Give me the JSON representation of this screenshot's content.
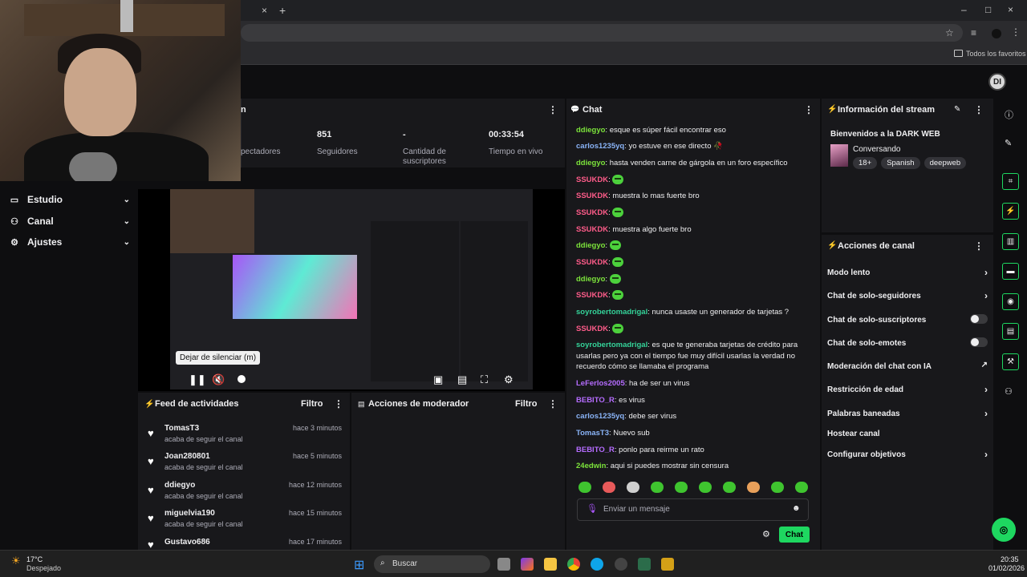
{
  "browser": {
    "new_tab": "+",
    "close_tab": "×",
    "bookmarks_label": "Todos los favoritos",
    "window_controls": [
      "–",
      "□",
      "×"
    ]
  },
  "app": {
    "user_initials": "DI"
  },
  "stats": {
    "title": "n",
    "items": [
      {
        "value": "",
        "label": "pectadores"
      },
      {
        "value": "851",
        "label": "Seguidores"
      },
      {
        "value": "-",
        "label": "Cantidad de suscriptores"
      },
      {
        "value": "00:33:54",
        "label": "Tiempo en vivo"
      }
    ]
  },
  "nav": {
    "items": [
      {
        "label": "Estudio",
        "icon": "monitor-icon"
      },
      {
        "label": "Canal",
        "icon": "users-icon"
      },
      {
        "label": "Ajustes",
        "icon": "gear-icon"
      }
    ]
  },
  "player": {
    "tooltip": "Dejar de silenciar (m)"
  },
  "feed": {
    "title": "Feed de actividades",
    "filter": "Filtro",
    "rows": [
      {
        "name": "TomasT3",
        "action": "acaba de seguir el canal",
        "time": "hace 3 minutos"
      },
      {
        "name": "Joan280801",
        "action": "acaba de seguir el canal",
        "time": "hace 5 minutos"
      },
      {
        "name": "ddiegyo",
        "action": "acaba de seguir el canal",
        "time": "hace 12 minutos"
      },
      {
        "name": "miguelvia190",
        "action": "acaba de seguir el canal",
        "time": "hace 15 minutos"
      },
      {
        "name": "Gustavo686",
        "action": "",
        "time": "hace 17 minutos"
      }
    ]
  },
  "mod": {
    "title": "Acciones de moderador",
    "filter": "Filtro"
  },
  "chat": {
    "title": "Chat",
    "messages": [
      {
        "user": "ddiegyo",
        "color": "#7ce33b",
        "text": "esque es súper fácil encontrar eso",
        "emote": false
      },
      {
        "user": "carlos1235yq",
        "color": "#8ab4f8",
        "text": "yo estuve en ese directo 🥀",
        "emote": false
      },
      {
        "user": "ddiegyo",
        "color": "#7ce33b",
        "text": "hasta venden carne de gárgola en un foro específico",
        "emote": false
      },
      {
        "user": "SSUKDK",
        "color": "#ff5c8a",
        "text": "",
        "emote": true
      },
      {
        "user": "SSUKDK",
        "color": "#ff5c8a",
        "text": "muestra lo mas fuerte bro",
        "emote": false
      },
      {
        "user": "SSUKDK",
        "color": "#ff5c8a",
        "text": "",
        "emote": true
      },
      {
        "user": "SSUKDK",
        "color": "#ff5c8a",
        "text": "muestra algo fuerte bro",
        "emote": false
      },
      {
        "user": "ddiegyo",
        "color": "#7ce33b",
        "text": "",
        "emote": true
      },
      {
        "user": "SSUKDK",
        "color": "#ff5c8a",
        "text": "",
        "emote": true
      },
      {
        "user": "ddiegyo",
        "color": "#7ce33b",
        "text": "",
        "emote": true
      },
      {
        "user": "SSUKDK",
        "color": "#ff5c8a",
        "text": "",
        "emote": true
      },
      {
        "user": "soyrobertomadrigal",
        "color": "#34d399",
        "text": "nunca usaste un generador de tarjetas ?",
        "emote": false
      },
      {
        "user": "SSUKDK",
        "color": "#ff5c8a",
        "text": "",
        "emote": true
      },
      {
        "user": "soyrobertomadrigal",
        "color": "#34d399",
        "text": "es que te generaba tarjetas de crédito para usarlas pero ya con el tiempo fue muy difícil usarlas la verdad no recuerdo cómo se llamaba el programa",
        "emote": false
      },
      {
        "user": "LeFerlos2005",
        "color": "#b56cff",
        "text": "ha de ser un virus",
        "emote": false
      },
      {
        "user": "BEBITO_R",
        "color": "#b56cff",
        "text": "es virus",
        "emote": false
      },
      {
        "user": "carlos1235yq",
        "color": "#8ab4f8",
        "text": "debe ser virus",
        "emote": false
      },
      {
        "user": "TomasT3",
        "color": "#8ab4f8",
        "text": "Nuevo sub",
        "emote": false
      },
      {
        "user": "BEBITO_R",
        "color": "#b56cff",
        "text": "ponlo para reirme un rato",
        "emote": false
      },
      {
        "user": "24edwin",
        "color": "#7ce33b",
        "text": "aqui si puedes mostrar sin censura",
        "emote": false
      }
    ],
    "placeholder": "Enviar un mensaje",
    "send": "Chat"
  },
  "info": {
    "title": "Información del stream",
    "stream_title": "Bienvenidos a la DARK WEB",
    "category": "Conversando",
    "tags": [
      "18+",
      "Spanish",
      "deepweb"
    ]
  },
  "actions": {
    "title": "Acciones de canal",
    "items": [
      {
        "label": "Modo lento",
        "kind": "chevron"
      },
      {
        "label": "Chat de solo-seguidores",
        "kind": "chevron"
      },
      {
        "label": "Chat de solo-suscriptores",
        "kind": "toggle"
      },
      {
        "label": "Chat de solo-emotes",
        "kind": "toggle"
      },
      {
        "label": "Moderación del chat con IA",
        "kind": "external"
      },
      {
        "label": "Restricción de edad",
        "kind": "chevron"
      },
      {
        "label": "Palabras baneadas",
        "kind": "chevron"
      },
      {
        "label": "Hostear canal",
        "kind": "none"
      },
      {
        "label": "Configurar objetivos",
        "kind": "chevron"
      }
    ]
  },
  "taskbar": {
    "weather_temp": "17°C",
    "weather_desc": "Despejado",
    "search": "Buscar",
    "time": "20:35",
    "date": "01/02/2026"
  },
  "colors": {
    "accent": "#1ed760",
    "panel": "#18181b",
    "bg": "#0e0e10"
  }
}
